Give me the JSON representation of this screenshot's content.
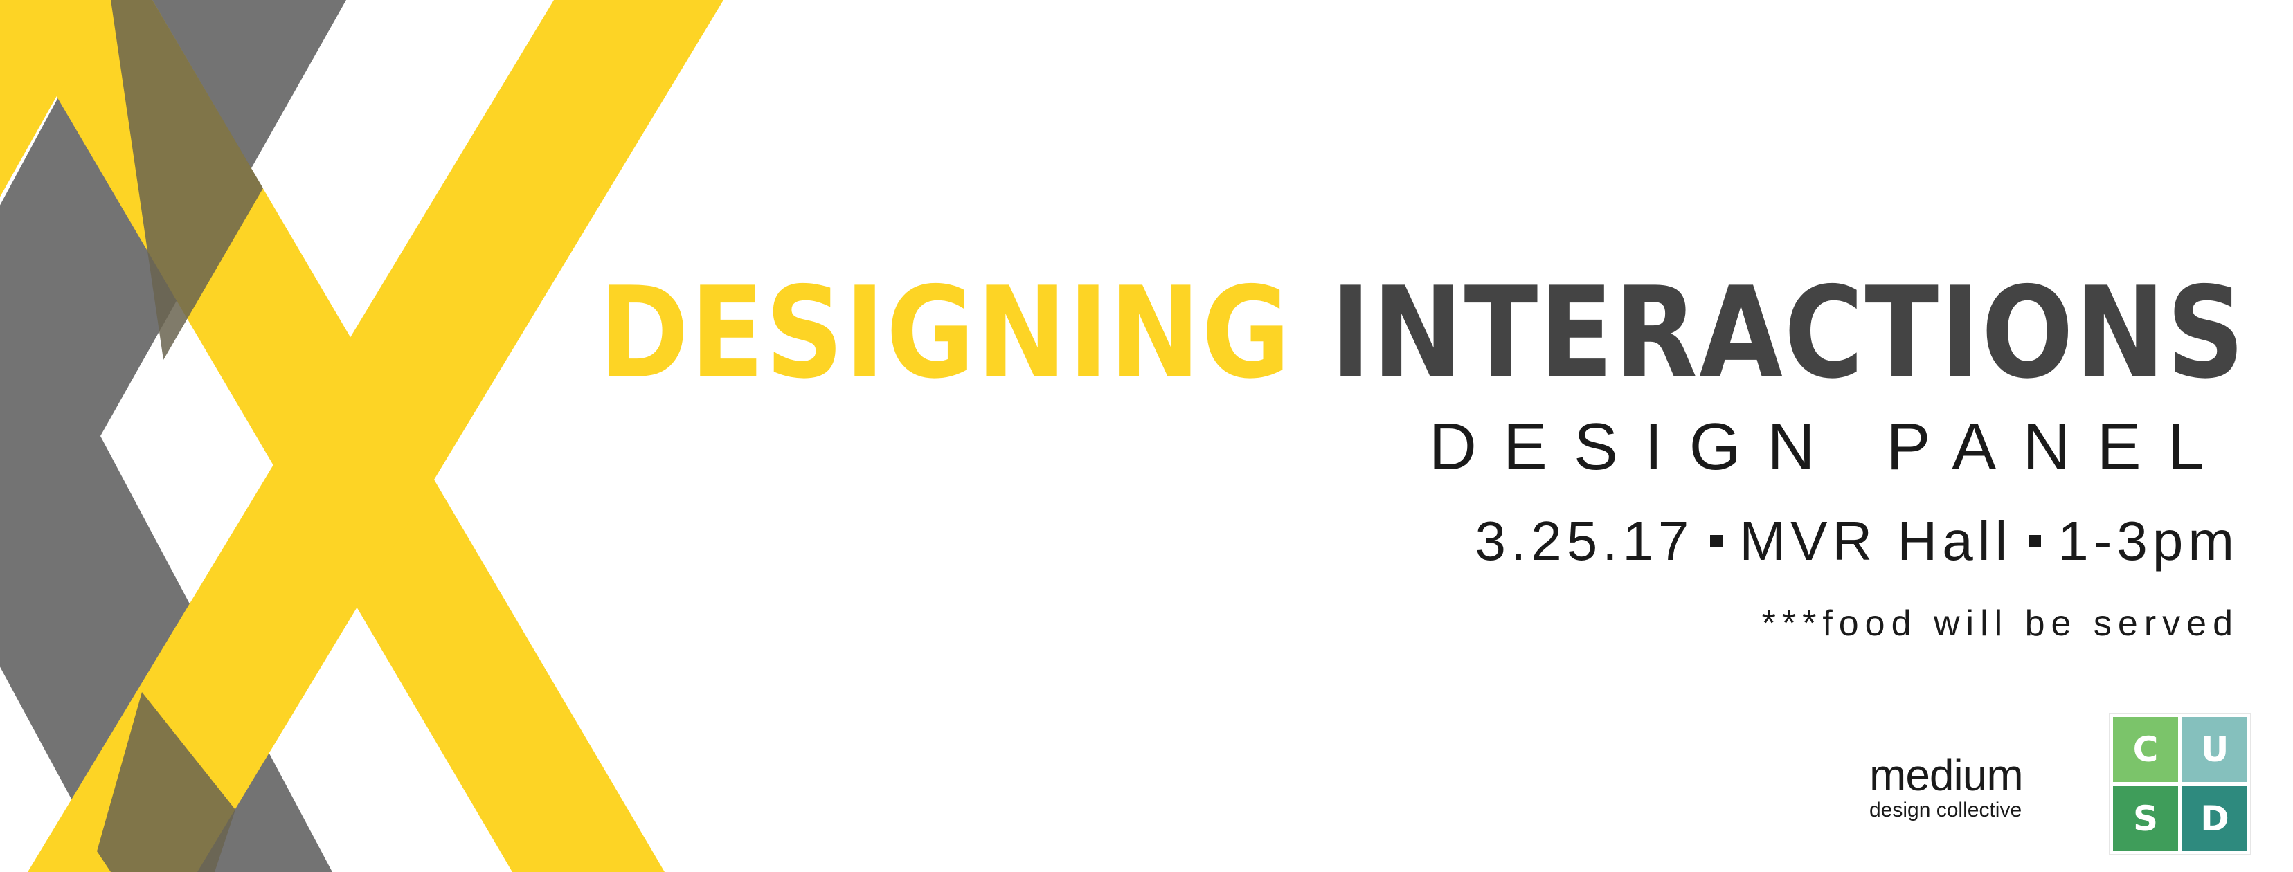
{
  "colors": {
    "yellow": "#fdd425",
    "gray": "#737373",
    "overlap": "#6a6450",
    "title_gray": "#444444",
    "text": "#1a1a1a",
    "logo_green": "#7bc46a",
    "logo_teal_light": "#85c0bd",
    "logo_green_dark": "#3f9d5a",
    "logo_teal_dark": "#2e8a7e"
  },
  "title": {
    "word1": "DESIGNING",
    "word2": "INTERACTIONS"
  },
  "subtitle": "DESIGN PANEL",
  "event": {
    "date": "3.25.17",
    "location": "MVR Hall",
    "time": "1-3pm"
  },
  "note": "***food will be served",
  "medium_logo": {
    "word": "medium",
    "tagline": "design collective"
  },
  "cusd_logo": {
    "letters": [
      "C",
      "U",
      "S",
      "D"
    ]
  }
}
